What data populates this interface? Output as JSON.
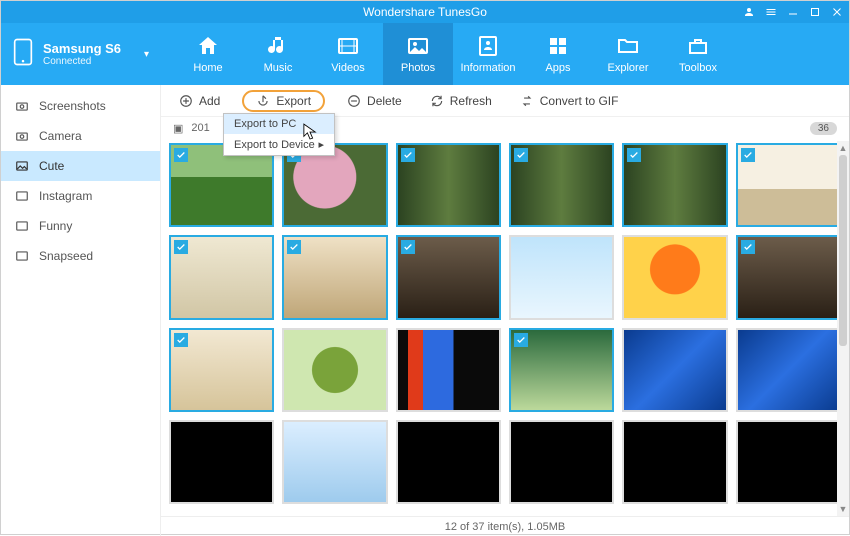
{
  "app": {
    "title": "Wondershare TunesGo"
  },
  "device": {
    "name": "Samsung S6",
    "status": "Connected"
  },
  "nav": {
    "items": [
      {
        "label": "Home"
      },
      {
        "label": "Music"
      },
      {
        "label": "Videos"
      },
      {
        "label": "Photos"
      },
      {
        "label": "Information"
      },
      {
        "label": "Apps"
      },
      {
        "label": "Explorer"
      },
      {
        "label": "Toolbox"
      }
    ],
    "active_index": 3
  },
  "sidebar": {
    "items": [
      {
        "label": "Screenshots"
      },
      {
        "label": "Camera"
      },
      {
        "label": "Cute"
      },
      {
        "label": "Instagram"
      },
      {
        "label": "Funny"
      },
      {
        "label": "Snapseed"
      }
    ],
    "active_index": 2
  },
  "toolbar": {
    "add": "Add",
    "export": "Export",
    "delete": "Delete",
    "refresh": "Refresh",
    "convert": "Convert to GIF"
  },
  "export_menu": {
    "to_pc": "Export to PC",
    "to_device": "Export to Device"
  },
  "group": {
    "year": "201",
    "count": "36"
  },
  "thumbs": [
    {
      "bg": "bg-grass",
      "selected": true
    },
    {
      "bg": "bg-flower",
      "selected": true
    },
    {
      "bg": "bg-forest",
      "selected": true
    },
    {
      "bg": "bg-forest",
      "selected": true
    },
    {
      "bg": "bg-forest",
      "selected": true
    },
    {
      "bg": "bg-bench",
      "selected": true
    },
    {
      "bg": "bg-wall",
      "selected": true
    },
    {
      "bg": "bg-kitten",
      "selected": true
    },
    {
      "bg": "bg-dark",
      "selected": true
    },
    {
      "bg": "bg-sky",
      "selected": false
    },
    {
      "bg": "bg-orange",
      "selected": false
    },
    {
      "bg": "bg-dark",
      "selected": true
    },
    {
      "bg": "bg-cubs",
      "selected": true
    },
    {
      "bg": "bg-logo",
      "selected": false
    },
    {
      "bg": "bg-flag",
      "selected": false
    },
    {
      "bg": "bg-butterfly",
      "selected": true
    },
    {
      "bg": "bg-xpblue",
      "selected": false
    },
    {
      "bg": "bg-xpblue",
      "selected": false
    },
    {
      "bg": "bg-black",
      "selected": false
    },
    {
      "bg": "bg-kitten2",
      "selected": false
    },
    {
      "bg": "bg-black",
      "selected": false
    },
    {
      "bg": "bg-black",
      "selected": false
    },
    {
      "bg": "bg-black",
      "selected": false
    },
    {
      "bg": "bg-black",
      "selected": false
    }
  ],
  "status": {
    "text": "12 of 37 item(s), 1.05MB"
  }
}
